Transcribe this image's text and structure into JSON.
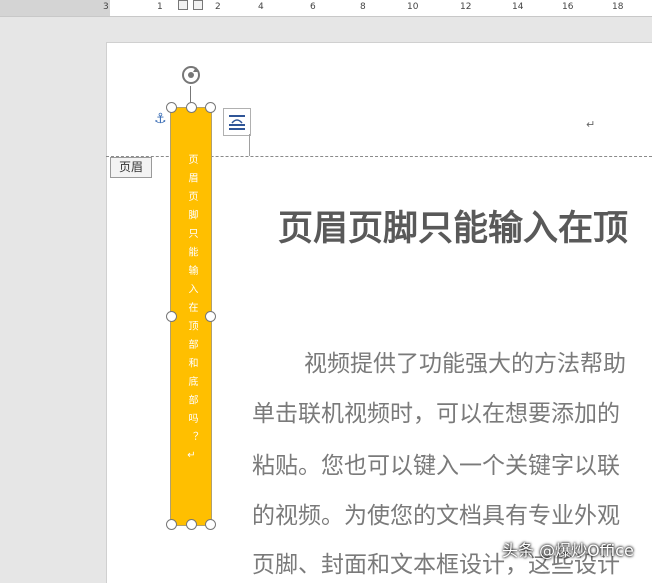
{
  "ruler": {
    "ticks": [
      "3",
      "1",
      "2",
      "4",
      "6",
      "8",
      "10",
      "12",
      "14",
      "16",
      "18"
    ],
    "minor_marks": [
      "|",
      "|",
      "|",
      "|",
      "|",
      "|",
      "|",
      "|",
      "|"
    ]
  },
  "header": {
    "tag_label": "页眉",
    "paragraph_mark": "↵"
  },
  "textbox": {
    "text": "页眉页脚只能输入在顶部和底部吗？↵",
    "fill_color": "#ffbf00"
  },
  "document": {
    "title": "页眉页脚只能输入在顶",
    "paragraphs": [
      "视频提供了功能强大的方法帮助",
      "单击联机视频时，可以在想要添加的",
      "粘贴。您也可以键入一个关键字以联",
      "的视频。为使您的文档具有专业外观",
      "页脚、封面和文本框设计，这些设计"
    ]
  },
  "watermark": {
    "text": "头条 @爆炒Office"
  },
  "icons": {
    "anchor": "anchor-icon",
    "layout": "layout-options-icon",
    "rotate": "rotate-icon"
  }
}
